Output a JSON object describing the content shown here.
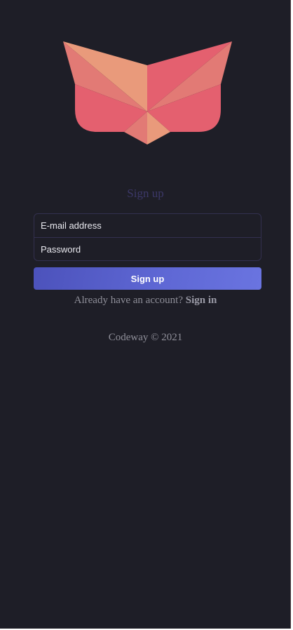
{
  "logo": {
    "icon": "fox-logo-icon",
    "colors": {
      "coral": "#e4606f",
      "peach": "#e99a7b",
      "salmon": "#e27a75"
    }
  },
  "signup": {
    "title": "Sign up",
    "email_placeholder": "E-mail address",
    "password_placeholder": "Password",
    "button_label": "Sign up"
  },
  "signin": {
    "prompt": "Already have an account? ",
    "link_label": "Sign in"
  },
  "footer": {
    "text": "Codeway © 2021"
  },
  "colors": {
    "background": "#1e1e27",
    "accent": "#5e67d4",
    "title": "#3c3868",
    "muted_text": "#8f8f99"
  }
}
